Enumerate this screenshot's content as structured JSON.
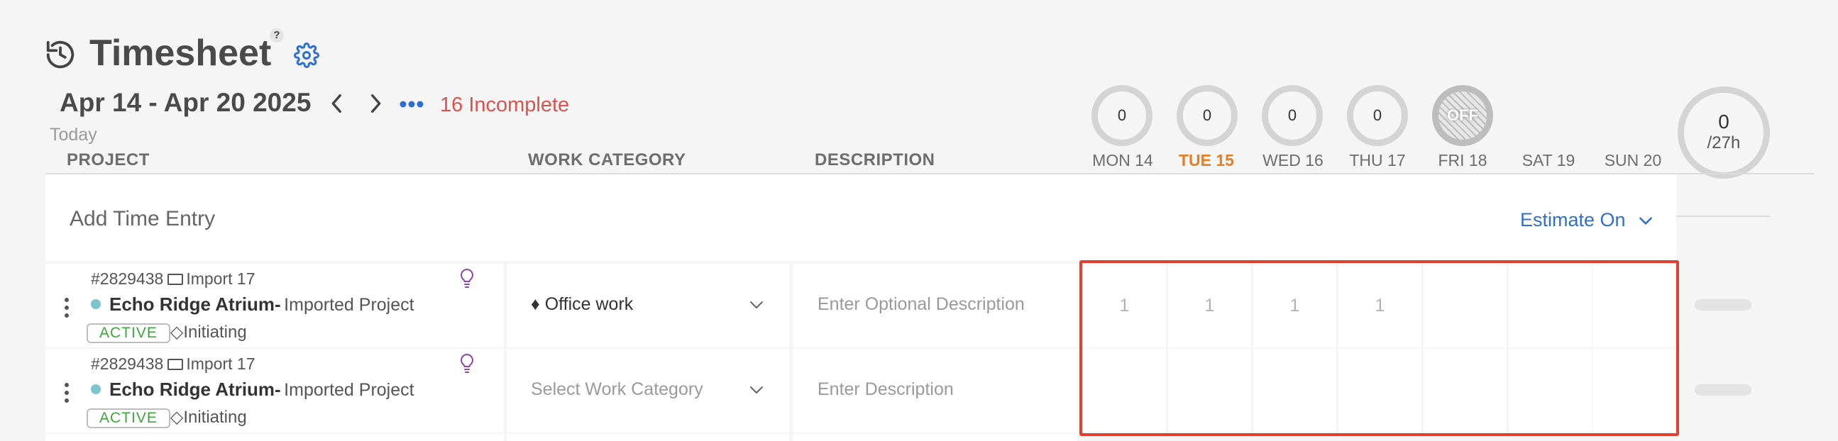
{
  "header": {
    "title": "Timesheet",
    "help_label": "?",
    "date_range": "Apr 14 - Apr 20 2025",
    "incomplete": "16 Incomplete",
    "today_label": "Today"
  },
  "columns": {
    "project": "PROJECT",
    "work_category": "WORK CATEGORY",
    "description": "DESCRIPTION"
  },
  "days": [
    {
      "label": "MON 14",
      "hours": "0",
      "today": false
    },
    {
      "label": "TUE 15",
      "hours": "0",
      "today": true
    },
    {
      "label": "WED 16",
      "hours": "0",
      "today": false
    },
    {
      "label": "THU 17",
      "hours": "0",
      "today": false
    },
    {
      "label": "FRI 18",
      "hours": "OFF",
      "today": false
    },
    {
      "label": "SAT 19",
      "hours": "",
      "today": false
    },
    {
      "label": "SUN 20",
      "hours": "",
      "today": false
    }
  ],
  "total": {
    "value": "0",
    "target": "/27h"
  },
  "add_entry": {
    "label": "Add Time Entry",
    "estimate": "Estimate On"
  },
  "rows": [
    {
      "id": "#2829438",
      "import": "Import 17",
      "name": "Echo Ridge Atrium-",
      "subtitle": "Imported Project",
      "status": "ACTIVE",
      "phase": "◇Initiating",
      "work_category": "♦ Office work",
      "description_placeholder": "Enter Optional Description",
      "hours": [
        "1",
        "1",
        "1",
        "1",
        "",
        "",
        ""
      ]
    },
    {
      "id": "#2829438",
      "import": "Import 17",
      "name": "Echo Ridge Atrium-",
      "subtitle": "Imported Project",
      "status": "ACTIVE",
      "phase": "◇Initiating",
      "work_category": "Select Work Category",
      "description_placeholder": "Enter Description",
      "hours": [
        "",
        "",
        "",
        "",
        "",
        "",
        ""
      ]
    }
  ],
  "colors": {
    "accent": "#2f6fd0",
    "incomplete": "#d9534f",
    "today": "#e67e22",
    "status": "#3aa83a",
    "highlight": "#e0402e"
  }
}
